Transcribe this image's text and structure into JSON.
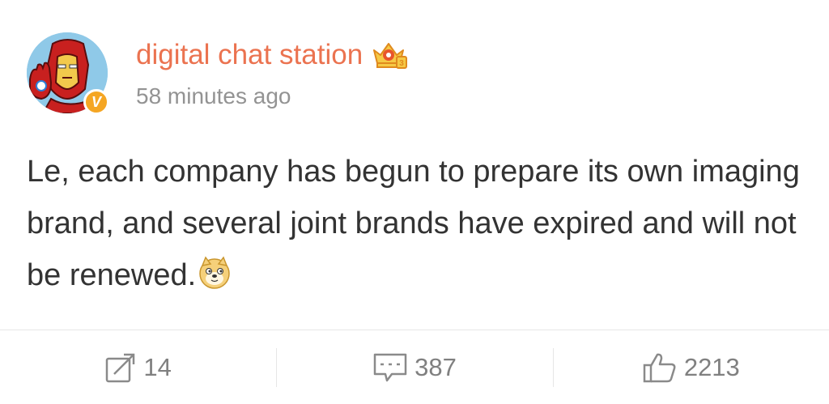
{
  "post": {
    "username": "digital chat station",
    "timestamp": "58 minutes ago",
    "text": "Le, each company has begun to prepare its own imaging brand, and several joint brands have expired and will not be renewed.",
    "avatar_icon": "iron-man-avatar",
    "badge_icon": "verified-v-badge",
    "member_icon": "crown-icon",
    "emoji_icon": "doge-emoji"
  },
  "actions": {
    "repost_count": "14",
    "comment_count": "387",
    "like_count": "2213"
  },
  "colors": {
    "username": "#eb7350",
    "timestamp": "#939393",
    "text": "#333333",
    "action": "#808080",
    "badge": "#f5a623"
  }
}
